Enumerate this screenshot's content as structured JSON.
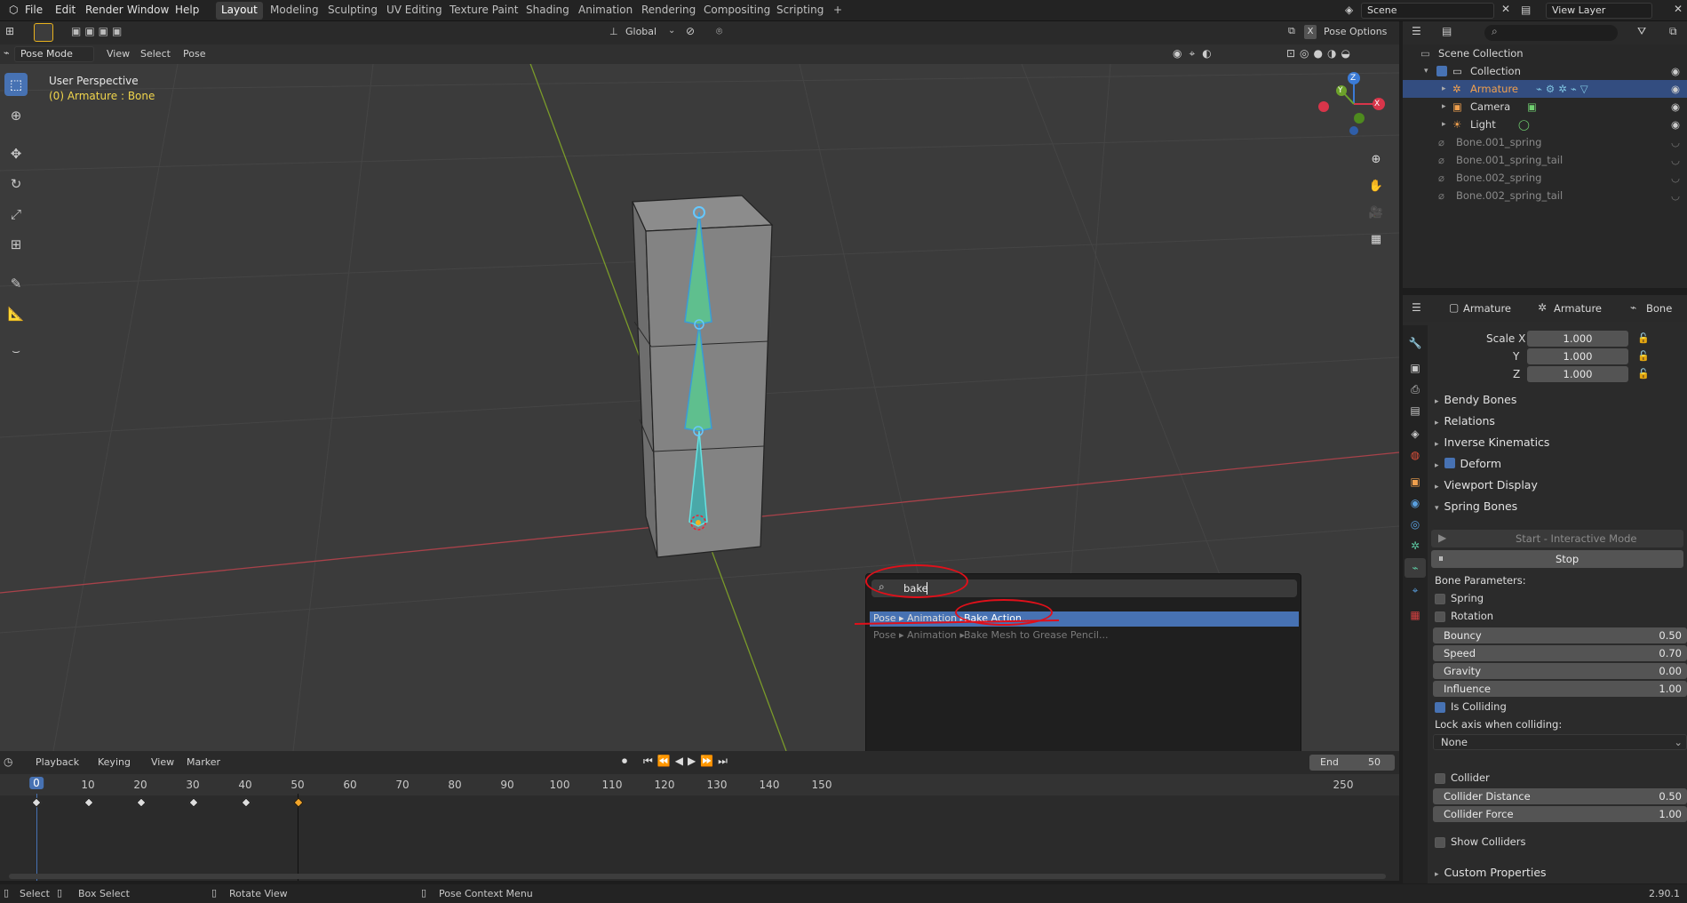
{
  "topbar": {
    "menus": [
      "File",
      "Edit",
      "Render",
      "Window",
      "Help"
    ],
    "workspaces": [
      "Layout",
      "Modeling",
      "Sculpting",
      "UV Editing",
      "Texture Paint",
      "Shading",
      "Animation",
      "Rendering",
      "Compositing",
      "Scripting"
    ],
    "active_workspace": "Layout",
    "add_tab": "+",
    "scene": "Scene",
    "view_layer": "View Layer"
  },
  "viewport_header": {
    "mode": "Pose Mode",
    "menus": [
      "View",
      "Select",
      "Pose"
    ],
    "transform_orientation": "Global",
    "pose_options": "Pose Options",
    "x_toggle": "X"
  },
  "viewport": {
    "view_name": "User Perspective",
    "object_info": "(0) Armature : Bone",
    "gizmo": {
      "x": "X",
      "y": "Y",
      "z": "Z"
    }
  },
  "search_popup": {
    "query": "bake",
    "results": [
      {
        "path": "Pose ▸ Animation ▸",
        "label": "Bake Action...",
        "selected": true
      },
      {
        "path": "Pose ▸ Animation ▸",
        "label": "Bake Mesh to Grease Pencil...",
        "selected": false
      }
    ]
  },
  "timeline_header": {
    "menus": [
      "Playback",
      "Keying",
      "View",
      "Marker"
    ],
    "end_label": "End",
    "end_value": "50"
  },
  "timeline": {
    "ticks": [
      "0",
      "10",
      "20",
      "30",
      "40",
      "50",
      "60",
      "70",
      "80",
      "90",
      "100",
      "110",
      "120",
      "130",
      "140",
      "150",
      "250"
    ],
    "current_frame": "0",
    "keyframes": [
      0,
      10,
      20,
      30,
      40,
      50
    ]
  },
  "statusbar": {
    "select": "Select",
    "box_select": "Box Select",
    "rotate_view": "Rotate View",
    "context_menu": "Pose Context Menu",
    "version": "2.90.1"
  },
  "outliner": {
    "scene_collection": "Scene Collection",
    "rows": [
      {
        "label": "Collection",
        "indent": 1
      },
      {
        "label": "Armature",
        "indent": 2
      },
      {
        "label": "Camera",
        "indent": 2
      },
      {
        "label": "Light",
        "indent": 2
      },
      {
        "label": "Bone.001_spring",
        "indent": 1
      },
      {
        "label": "Bone.001_spring_tail",
        "indent": 1
      },
      {
        "label": "Bone.002_spring",
        "indent": 1
      },
      {
        "label": "Bone.002_spring_tail",
        "indent": 1
      }
    ]
  },
  "properties": {
    "breadcrumb": [
      "Armature",
      "Armature",
      "Bone"
    ],
    "scale": {
      "x_label": "Scale X",
      "y_label": "Y",
      "z_label": "Z",
      "x": "1.000",
      "y": "1.000",
      "z": "1.000"
    },
    "panels": [
      "Bendy Bones",
      "Relations",
      "Inverse Kinematics",
      "Deform",
      "Viewport Display",
      "Spring Bones"
    ],
    "spring": {
      "start_label": "Start - Interactive Mode",
      "stop_label": "Stop",
      "bone_params": "Bone Parameters:",
      "spring": "Spring",
      "rotation": "Rotation",
      "bouncy_label": "Bouncy",
      "bouncy": "0.50",
      "speed_label": "Speed",
      "speed": "0.70",
      "gravity_label": "Gravity",
      "gravity": "0.00",
      "influence_label": "Influence",
      "influence": "1.00",
      "is_colliding": "Is Colliding",
      "lock_axis_label": "Lock axis when colliding:",
      "lock_axis_value": "None",
      "collider": "Collider",
      "collider_distance_label": "Collider Distance",
      "collider_distance": "0.50",
      "collider_force_label": "Collider Force",
      "collider_force": "1.00",
      "show_colliders": "Show Colliders",
      "custom_props": "Custom Properties"
    }
  }
}
